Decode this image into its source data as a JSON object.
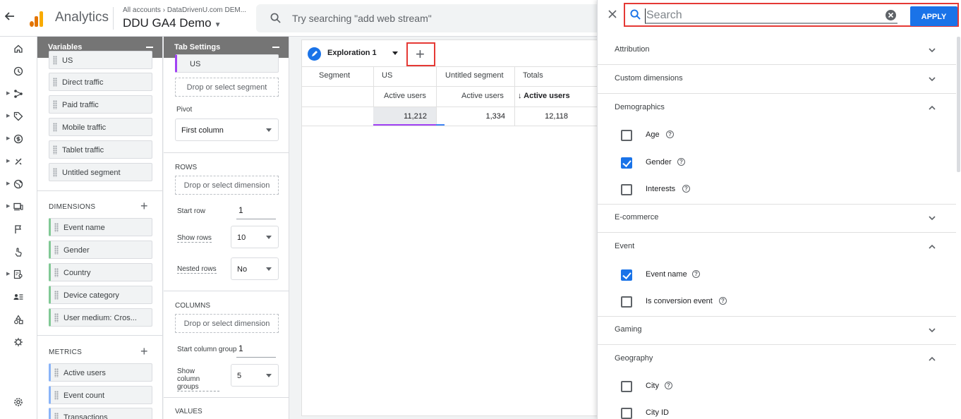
{
  "header": {
    "app_title": "Analytics",
    "breadcrumb": "All accounts",
    "breadcrumb_sep": "›",
    "breadcrumb_account": "DataDrivenU.com DEM...",
    "property": "DDU GA4 Demo",
    "search_placeholder": "Try searching \"add web stream\"",
    "logo_colors": [
      "#f9ab00",
      "#e37400",
      "#e37400"
    ]
  },
  "rail": {
    "icons": [
      "home-icon",
      "reports-icon",
      "explore-icon",
      "tag-icon",
      "monetization-icon",
      "engagement-icon",
      "globe-icon",
      "devices-icon",
      "flag-icon",
      "touch-icon",
      "user-report-icon",
      "user-list-icon",
      "shapes-icon",
      "debug-icon",
      "settings-icon"
    ]
  },
  "variables": {
    "title": "Variables",
    "segments": [
      "US",
      "Direct traffic",
      "Paid traffic",
      "Mobile traffic",
      "Tablet traffic",
      "Untitled segment"
    ],
    "dimensions_label": "DIMENSIONS",
    "dimensions": [
      "Event name",
      "Gender",
      "Country",
      "Device category",
      "User medium: Cros..."
    ],
    "metrics_label": "METRICS",
    "metrics": [
      "Active users",
      "Event count",
      "Transactions"
    ]
  },
  "tab_settings": {
    "title": "Tab Settings",
    "segment_chip": "US",
    "drop_segment": "Drop or select segment",
    "pivot_label": "Pivot",
    "pivot_value": "First column",
    "rows_label": "ROWS",
    "drop_dimension": "Drop or select dimension",
    "start_row_label": "Start row",
    "start_row_value": "1",
    "show_rows_label": "Show rows",
    "show_rows_value": "10",
    "nested_rows_label": "Nested rows",
    "nested_rows_value": "No",
    "columns_label": "COLUMNS",
    "drop_column_dimension": "Drop or select dimension",
    "start_column_group_label": "Start column group",
    "start_column_group_value": "1",
    "show_column_groups_label": "Show column groups",
    "show_column_groups_value": "5",
    "values_label": "VALUES"
  },
  "canvas": {
    "tab_name": "Exploration 1",
    "table": {
      "headers": [
        "Segment",
        "US",
        "Untitled segment",
        "Totals"
      ],
      "metric_row": [
        "Active users",
        "Active users",
        "↓ Active users"
      ],
      "values": [
        "11,212",
        "1,334",
        "12,118"
      ]
    }
  },
  "picker": {
    "search_placeholder": "Search",
    "search_value": "",
    "apply_label": "APPLY",
    "categories": [
      {
        "label": "Attribution",
        "expanded": false
      },
      {
        "label": "Custom dimensions",
        "expanded": false
      },
      {
        "label": "Demographics",
        "expanded": true,
        "options": [
          {
            "label": "Age",
            "checked": false
          },
          {
            "label": "Gender",
            "checked": true
          },
          {
            "label": "Interests",
            "checked": false
          }
        ]
      },
      {
        "label": "E-commerce",
        "expanded": false
      },
      {
        "label": "Event",
        "expanded": true,
        "options": [
          {
            "label": "Event name",
            "checked": true
          },
          {
            "label": "Is conversion event",
            "checked": false
          }
        ]
      },
      {
        "label": "Gaming",
        "expanded": false
      },
      {
        "label": "Geography",
        "expanded": true,
        "options": [
          {
            "label": "City",
            "checked": false
          },
          {
            "label": "City ID",
            "checked": false
          }
        ]
      }
    ]
  },
  "colors": {
    "accent": "#1a73e8",
    "highlight": "#e53935",
    "panel_header": "#757575"
  }
}
